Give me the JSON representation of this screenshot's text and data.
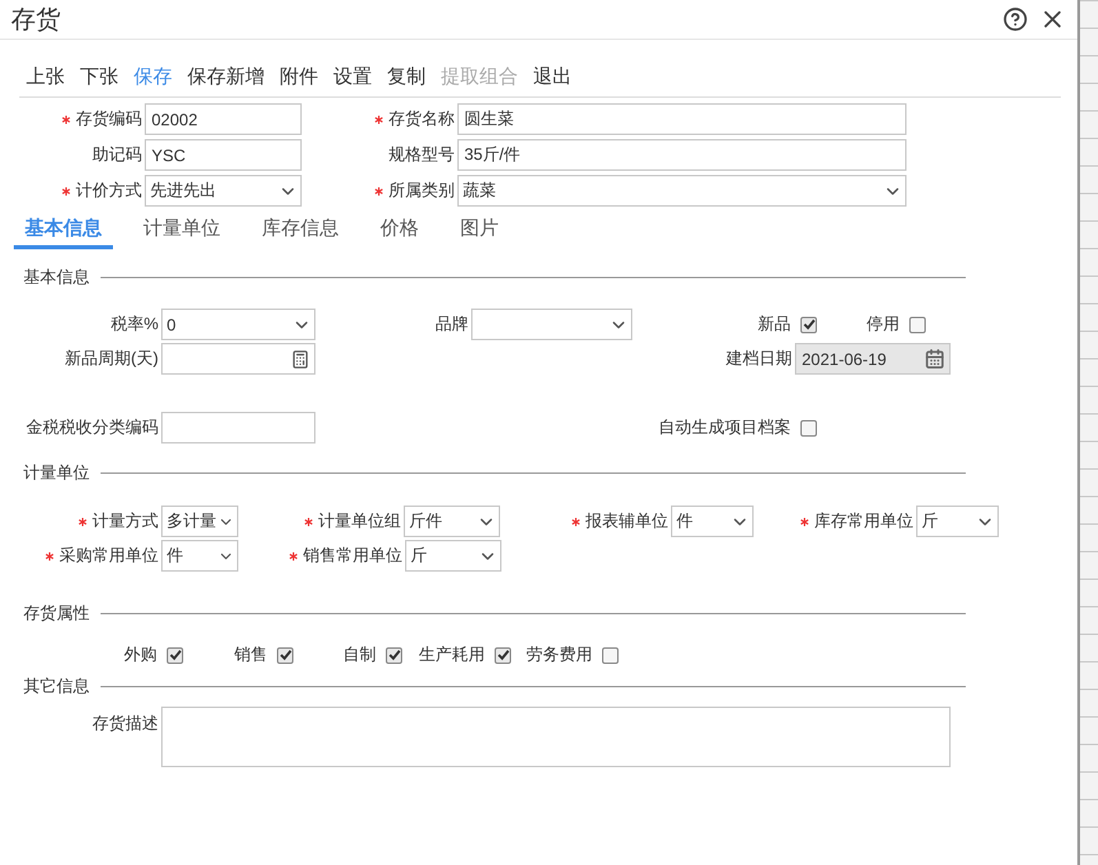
{
  "window": {
    "title": "存货"
  },
  "toolbar": [
    {
      "label": "上张",
      "highlighted": false,
      "disabled": false
    },
    {
      "label": "下张",
      "highlighted": false,
      "disabled": false
    },
    {
      "label": "保存",
      "highlighted": true,
      "disabled": false
    },
    {
      "label": "保存新增",
      "highlighted": false,
      "disabled": false
    },
    {
      "label": "附件",
      "highlighted": false,
      "disabled": false
    },
    {
      "label": "设置",
      "highlighted": false,
      "disabled": false
    },
    {
      "label": "复制",
      "highlighted": false,
      "disabled": false
    },
    {
      "label": "提取组合",
      "highlighted": false,
      "disabled": true
    },
    {
      "label": "退出",
      "highlighted": false,
      "disabled": false
    }
  ],
  "header_fields": [
    {
      "label": "存货编码",
      "required": true,
      "kind": "input",
      "value": "02002"
    },
    {
      "label": "存货名称",
      "required": true,
      "kind": "input",
      "value": "圆生菜"
    },
    {
      "label": "助记码",
      "required": false,
      "kind": "input",
      "value": "YSC"
    },
    {
      "label": "规格型号",
      "required": false,
      "kind": "input",
      "value": "35斤/件"
    },
    {
      "label": "计价方式",
      "required": true,
      "kind": "select",
      "value": "先进先出"
    },
    {
      "label": "所属类别",
      "required": true,
      "kind": "select",
      "value": "蔬菜"
    }
  ],
  "tabs": [
    {
      "label": "基本信息",
      "selected": true
    },
    {
      "label": "计量单位",
      "selected": false
    },
    {
      "label": "库存信息",
      "selected": false
    },
    {
      "label": "价格",
      "selected": false
    },
    {
      "label": "图片",
      "selected": false
    }
  ],
  "basic_info": {
    "title": "基本信息",
    "tax_rate": {
      "label": "税率%",
      "kind": "select",
      "value": "0"
    },
    "brand": {
      "label": "品牌",
      "kind": "select"
    },
    "new_product": {
      "label": "新品",
      "checked": true
    },
    "disabled_flag": {
      "label": "停用",
      "checked": false
    },
    "new_period": {
      "label": "新品周期(天)",
      "kind": "calc"
    },
    "created_date": {
      "label": "建档日期",
      "kind": "date",
      "value": "2021-06-19"
    },
    "tax_code": {
      "label": "金税税收分类编码",
      "kind": "input"
    },
    "auto_project": {
      "label": "自动生成项目档案",
      "checked": false
    }
  },
  "units": {
    "title": "计量单位",
    "fields": [
      {
        "label": "计量方式",
        "required": true,
        "value": "多计量"
      },
      {
        "label": "计量单位组",
        "required": true,
        "value": "斤件"
      },
      {
        "label": "报表辅单位",
        "required": true,
        "value": "件"
      },
      {
        "label": "库存常用单位",
        "required": true,
        "value": "斤"
      },
      {
        "label": "采购常用单位",
        "required": true,
        "value": "件"
      },
      {
        "label": "销售常用单位",
        "required": true,
        "value": "斤"
      }
    ]
  },
  "attributes": {
    "title": "存货属性",
    "items": [
      {
        "label": "外购",
        "checked": true
      },
      {
        "label": "销售",
        "checked": true
      },
      {
        "label": "自制",
        "checked": true
      },
      {
        "label": "生产耗用",
        "checked": true
      },
      {
        "label": "劳务费用",
        "checked": false
      }
    ]
  },
  "other": {
    "title": "其它信息",
    "description": {
      "label": "存货描述"
    }
  }
}
